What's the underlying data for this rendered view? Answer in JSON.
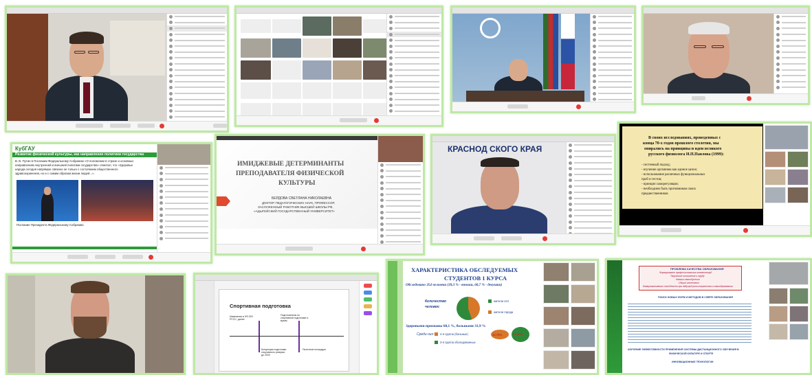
{
  "tiles": {
    "t6": {
      "lines": [
        "Развитие физической культуры, как направление политики государства"
      ],
      "body": [
        "В. В. Путин в Послании Федеральному Собранию «О положении в стране и основных",
        "направлениях внутренней и внешней политики государства» отметил, что «Здоровье",
        "народа сегодня напрямую связано не только с состоянием общественного",
        "здравоохранения, но и с самим образом жизни людей...»."
      ],
      "caption": "Послание Президента Федеральному Собранию"
    },
    "t7": {
      "title": [
        "ИМИДЖЕВЫЕ ДЕТЕРМИНАНТЫ",
        "ПРЕПОДАВАТЕЛЯ ФИЗИЧЕСКОЙ",
        "КУЛЬТУРЫ"
      ],
      "author": [
        "БЕРДОВА СВЕТЛАНА НИКОЛАЕВНА",
        "ДОКТОР ПЕДАГОГИЧЕСКИХ НАУК, ПРОФЕССОР,",
        "ЗАСЛУЖЕННЫЙ РАБОТНИК ВЫСШЕЙ ШКОЛЫ РФ,",
        "«АДЫГЕЙСКИЙ ГОСУДАРСТВЕННЫЙ УНИВЕРСИТЕТ»"
      ]
    },
    "t8": {
      "banner": "КРАСНОД  СКОГО КРАЯ"
    },
    "t9": {
      "lines": [
        "В своих исследованиях, проведенных с",
        "конца 70-х годов прошлого столетия, мы",
        "опирались на принципы и идеи великого",
        "русского физиолога И.П.Павлова (1999):"
      ],
      "bullets": [
        "- системный подход;",
        "- изучение организма как единое целое;",
        "- использование различных функциональных",
        "проб и тестов;",
        "- принцип саморегуляции;",
        "- необходимо быть противником своих",
        "предшественников"
      ]
    },
    "t11": {
      "title": "Спортивная подготовка",
      "items": [
        "Изменения в ФЗ 329\nРССС, далее",
        "Подготовлены по\nспортивной подготовке и\nвузам",
        "Концепция подготовки\nспортивного резерва\nдо 2020",
        "Пилотные площадки"
      ]
    },
    "t12": {
      "title": [
        "ХАРАКТЕРИСТИКА ОБСЛЕДУЕМЫХ",
        "СТУДЕНТОВ 1 КУРСА"
      ],
      "subtitle": "Обследовано 354 человека (39,3 % - юноши, 60,7 % - девушки)",
      "q1": "Количество",
      "q2": "человек:",
      "health": "Здоровыми признаны 68,1 %, больными 31,9 %",
      "among": "Среди них:",
      "legend": [
        "4-я группа (больные)",
        "3-я группа обследованных"
      ],
      "pct": [
        "12,79%",
        "19,20%"
      ],
      "leg2": [
        "жители сёл",
        "жители города"
      ]
    },
    "t13": {
      "head": [
        "ПРОБЛЕМА КАЧЕСТВА ОБРАЗОВАНИЯ"
      ],
      "sub": [
        "Формирование профессиональных компетенций",
        "Творческое отношение к труду",
        "Навыки самообучения",
        "Общий интеллект",
        "Коммуникативные способности при ведущей роли творчества и самообразования"
      ],
      "mid": "ПОИСК НОВЫХ ФОРМ И МЕТОДОВ В СФЕРЕ ОБРАЗОВАНИЯ",
      "bottom": [
        "ИЗУЧЕНИЕ ЭФФЕКТИВНОСТИ ПРИМЕНЕНИЯ СИСТЕМЫ ДИСТАНЦИОННОГО ОБУЧЕНИЯ В",
        "ФИЗИЧЕСКОЙ КУЛЬТУРЕ И СПОРТЕ"
      ],
      "tech": "ИННОВАЦИОННЫЕ ТЕХНОЛОГИИ"
    }
  },
  "colors": {
    "tile_border": "#bfe8a6",
    "green_band": "#2e9a3a",
    "record": "#e53935"
  }
}
